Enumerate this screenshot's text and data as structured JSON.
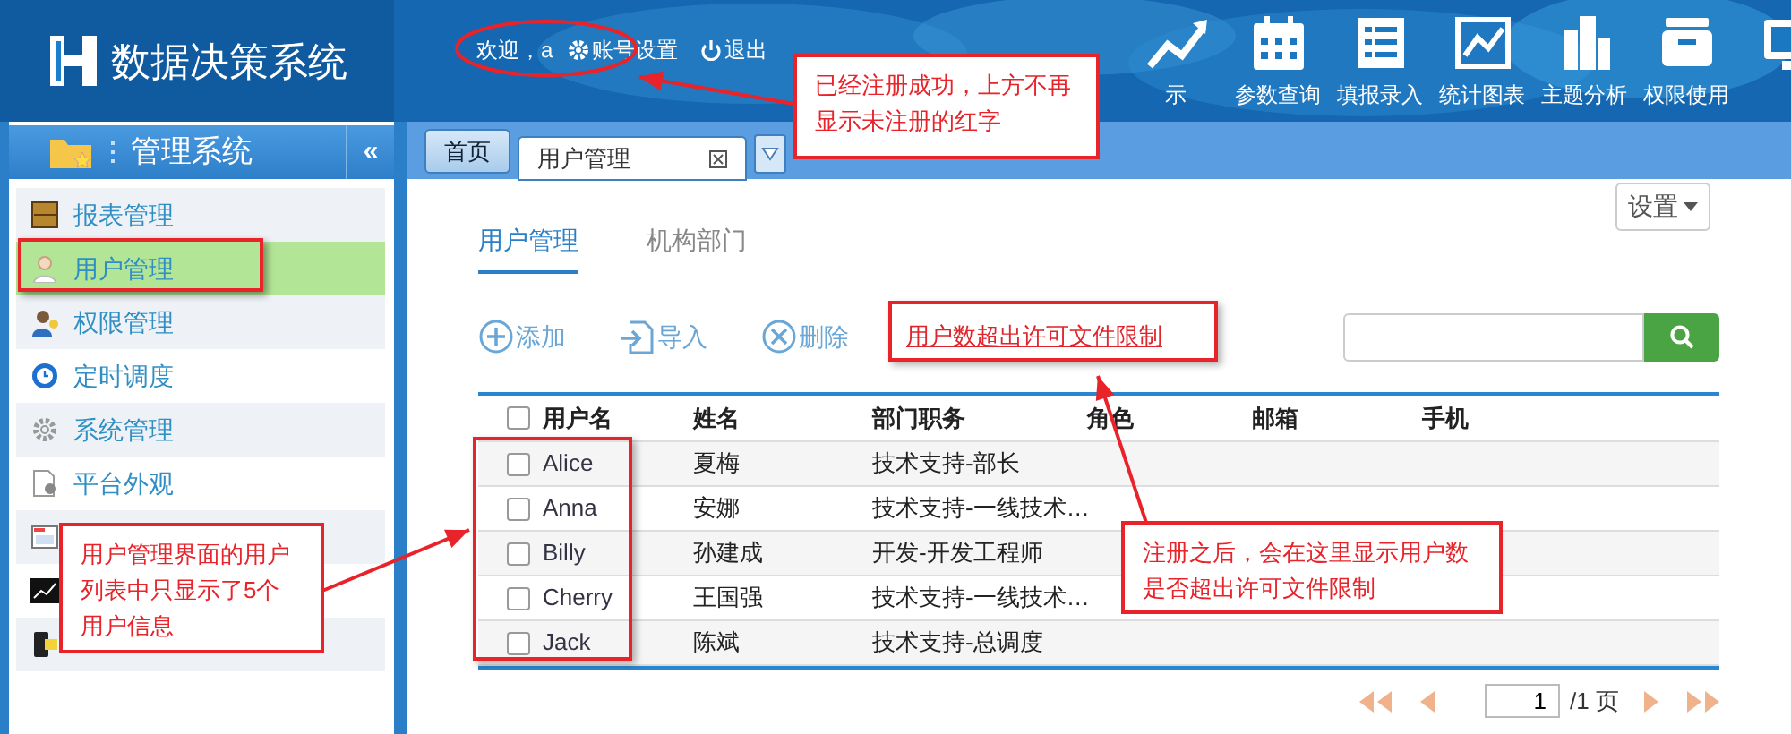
{
  "header": {
    "title": "数据决策系统",
    "welcome": "欢迎，a",
    "account": "账号设置",
    "logout": "退出",
    "nav": [
      {
        "label": "示",
        "kind": "trend"
      },
      {
        "label": "参数查询",
        "kind": "calendar"
      },
      {
        "label": "填报录入",
        "kind": "list"
      },
      {
        "label": "统计图表",
        "kind": "chart"
      },
      {
        "label": "主题分析",
        "kind": "building"
      },
      {
        "label": "权限使用",
        "kind": "box"
      },
      {
        "kind": "monitor"
      }
    ]
  },
  "sidebar": {
    "title": "管理系统",
    "collapse": "«",
    "items": [
      {
        "label": "报表管理",
        "kind": "cabinet",
        "selected": false
      },
      {
        "label": "用户管理",
        "kind": "user",
        "selected": true
      },
      {
        "label": "权限管理",
        "kind": "key-user",
        "selected": false
      },
      {
        "label": "定时调度",
        "kind": "clock",
        "selected": false
      },
      {
        "label": "系统管理",
        "kind": "gear",
        "selected": false
      },
      {
        "label": "平台外观",
        "kind": "doc",
        "selected": false
      },
      {
        "kind": "window",
        "selected": false
      },
      {
        "kind": "graph",
        "selected": false
      },
      {
        "kind": "phone",
        "selected": false
      }
    ]
  },
  "tabs": [
    {
      "label": "首页",
      "selected": false,
      "closable": false
    },
    {
      "label": "用户管理",
      "selected": true,
      "closable": true
    }
  ],
  "settings_button": "设置",
  "subtabs": [
    {
      "label": "用户管理",
      "selected": true
    },
    {
      "label": "机构部门",
      "selected": false
    }
  ],
  "toolbar": [
    {
      "label": "添加",
      "kind": "add"
    },
    {
      "label": "导入",
      "kind": "import"
    },
    {
      "label": "删除",
      "kind": "delete"
    }
  ],
  "license_warning": "用户数超出许可文件限制",
  "table": {
    "all_checked": false,
    "columns": [
      "用户名",
      "姓名",
      "部门职务",
      "角色",
      "邮箱",
      "手机"
    ],
    "rows": [
      {
        "checked": false,
        "cells": [
          "Alice",
          "夏梅",
          "技术支持-部长"
        ]
      },
      {
        "checked": false,
        "cells": [
          "Anna",
          "安娜",
          "技术支持-一线技术…"
        ]
      },
      {
        "checked": false,
        "cells": [
          "Billy",
          "孙建成",
          "开发-开发工程师"
        ]
      },
      {
        "checked": false,
        "cells": [
          "Cherry",
          "王国强",
          "技术支持-一线技术…"
        ]
      },
      {
        "checked": false,
        "cells": [
          "Jack",
          "陈斌",
          "技术支持-总调度"
        ]
      }
    ]
  },
  "pagination": {
    "page": "1",
    "total": "/1 页"
  },
  "annotations": [
    {
      "kind": "callout",
      "text": "已经注册成功，上方不再显示未注册的红字"
    },
    {
      "kind": "callout",
      "text": "用户管理界面的用户列表中只显示了5个用户信息"
    },
    {
      "kind": "callout",
      "text": "注册之后，会在这里显示用户数是否超出许可文件限制"
    }
  ]
}
